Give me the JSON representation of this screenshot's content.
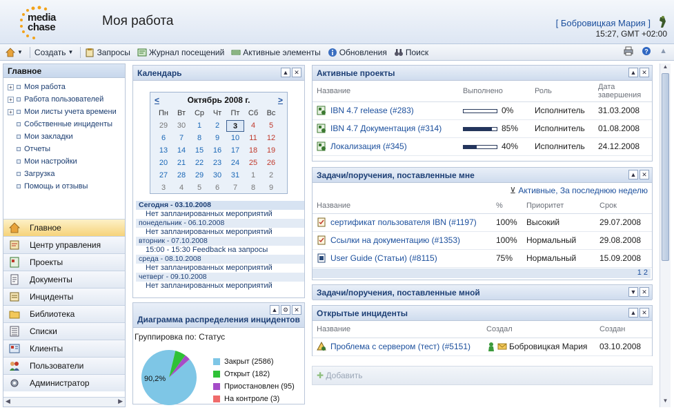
{
  "app": {
    "logo_line1": "media",
    "logo_line2": "chase",
    "title": "Моя работа"
  },
  "user": {
    "name": "[ Бобровицкая Мария ]",
    "time": "15:27, GMT +02:00"
  },
  "toolbar": {
    "create": "Создать",
    "requests": "Запросы",
    "visit_log": "Журнал посещений",
    "active_items": "Активные элементы",
    "updates": "Обновления",
    "search": "Поиск"
  },
  "sidebar": {
    "title": "Главное",
    "tree": [
      {
        "label": "Моя работа",
        "expandable": true
      },
      {
        "label": "Работа пользователей",
        "expandable": true
      },
      {
        "label": "Мои листы учета времени",
        "expandable": true
      },
      {
        "label": "Собственные инциденты",
        "expandable": false
      },
      {
        "label": "Мои закладки",
        "expandable": false
      },
      {
        "label": "Отчеты",
        "expandable": false
      },
      {
        "label": "Мои настройки",
        "expandable": false
      },
      {
        "label": "Загрузка",
        "expandable": false
      },
      {
        "label": "Помощь и отзывы",
        "expandable": false
      }
    ],
    "nav": [
      {
        "label": "Главное",
        "icon": "home-icon",
        "active": true
      },
      {
        "label": "Центр управления",
        "icon": "control-center-icon",
        "active": false
      },
      {
        "label": "Проекты",
        "icon": "projects-icon",
        "active": false
      },
      {
        "label": "Документы",
        "icon": "documents-icon",
        "active": false
      },
      {
        "label": "Инциденты",
        "icon": "incidents-icon",
        "active": false
      },
      {
        "label": "Библиотека",
        "icon": "folder-icon",
        "active": false
      },
      {
        "label": "Списки",
        "icon": "lists-icon",
        "active": false
      },
      {
        "label": "Клиенты",
        "icon": "clients-icon",
        "active": false
      },
      {
        "label": "Пользователи",
        "icon": "users-icon",
        "active": false
      },
      {
        "label": "Администратор",
        "icon": "admin-icon",
        "active": false
      }
    ]
  },
  "calendar": {
    "title": "Календарь",
    "prev": "<",
    "next": ">",
    "month": "Октябрь 2008 г.",
    "dow": [
      "Пн",
      "Вт",
      "Ср",
      "Чт",
      "Пт",
      "Сб",
      "Вс"
    ],
    "weeks": [
      [
        "29",
        "30",
        "1",
        "2",
        "3",
        "4",
        "5"
      ],
      [
        "6",
        "7",
        "8",
        "9",
        "10",
        "11",
        "12"
      ],
      [
        "13",
        "14",
        "15",
        "16",
        "17",
        "18",
        "19"
      ],
      [
        "20",
        "21",
        "22",
        "23",
        "24",
        "25",
        "26"
      ],
      [
        "27",
        "28",
        "29",
        "30",
        "31",
        "1",
        "2"
      ],
      [
        "3",
        "4",
        "5",
        "6",
        "7",
        "8",
        "9"
      ]
    ],
    "today_cell": [
      0,
      4
    ],
    "agenda": [
      {
        "day": "Сегодня - 03.10.2008",
        "bold": true,
        "event": "Нет запланированных мероприятий"
      },
      {
        "day": "понедельник - 06.10.2008",
        "bold": false,
        "event": "Нет запланированных мероприятий"
      },
      {
        "day": "вторник - 07.10.2008",
        "bold": false,
        "event": "15:00 - 15:30  Feedback на запросы"
      },
      {
        "day": "среда - 08.10.2008",
        "bold": false,
        "event": "Нет запланированных мероприятий"
      },
      {
        "day": "четверг - 09.10.2008",
        "bold": false,
        "event": "Нет запланированных мероприятий"
      }
    ]
  },
  "incident_chart": {
    "title": "Диаграмма распределения инцидентов",
    "grouping": "Группировка по: Статус",
    "pie_label": "90,2%"
  },
  "chart_data": {
    "type": "pie",
    "categories": [
      "Закрыт",
      "Открыт",
      "Приостановлен",
      "На контроле"
    ],
    "values": [
      2586,
      182,
      95,
      3
    ],
    "colors": [
      "#7ec6e6",
      "#2fc137",
      "#a54cc8",
      "#ef6b6b"
    ],
    "legend": [
      "Закрыт (2586)",
      "Открыт (182)",
      "Приостановлен (95)",
      "На контроле (3)"
    ]
  },
  "projects": {
    "title": "Активные проекты",
    "columns": [
      "Название",
      "Выполнено",
      "Роль",
      "Дата завершения"
    ],
    "rows": [
      {
        "name": "IBN 4.7 release (#283)",
        "progress": 0,
        "progress_label": "0%",
        "role": "Исполнитель",
        "date": "31.03.2008"
      },
      {
        "name": "IBN 4.7 Документация (#314)",
        "progress": 85,
        "progress_label": "85%",
        "role": "Исполнитель",
        "date": "01.08.2008"
      },
      {
        "name": "Локализация (#345)",
        "progress": 40,
        "progress_label": "40%",
        "role": "Исполнитель",
        "date": "24.12.2008"
      }
    ]
  },
  "tasks_to_me": {
    "title": "Задачи/поручения, поставленные мне",
    "filter": "Активные, За последнюю неделю",
    "columns": [
      "Название",
      "%",
      "Приоритет",
      "Срок"
    ],
    "rows": [
      {
        "name": "сертификат пользователя IBN  (#1197)",
        "pct": "100%",
        "priority": "Высокий",
        "due": "29.07.2008"
      },
      {
        "name": "Ссылки на документацию (#1353)",
        "pct": "100%",
        "priority": "Нормальный",
        "due": "29.08.2008"
      },
      {
        "name": "User Guide (Статьи) (#8115)",
        "pct": "75%",
        "priority": "Нормальный",
        "due": "15.09.2008"
      }
    ],
    "pages": [
      "1",
      "2"
    ]
  },
  "tasks_by_me": {
    "title": "Задачи/поручения, поставленные мной"
  },
  "open_incidents": {
    "title": "Открытые инциденты",
    "columns": [
      "Название",
      "Создал",
      "Создан"
    ],
    "rows": [
      {
        "name": "Проблема с сервером (тест) (#5151)",
        "creator": "Бобровицкая Мария",
        "created": "03.10.2008"
      }
    ]
  },
  "add": {
    "label": "Добавить"
  }
}
